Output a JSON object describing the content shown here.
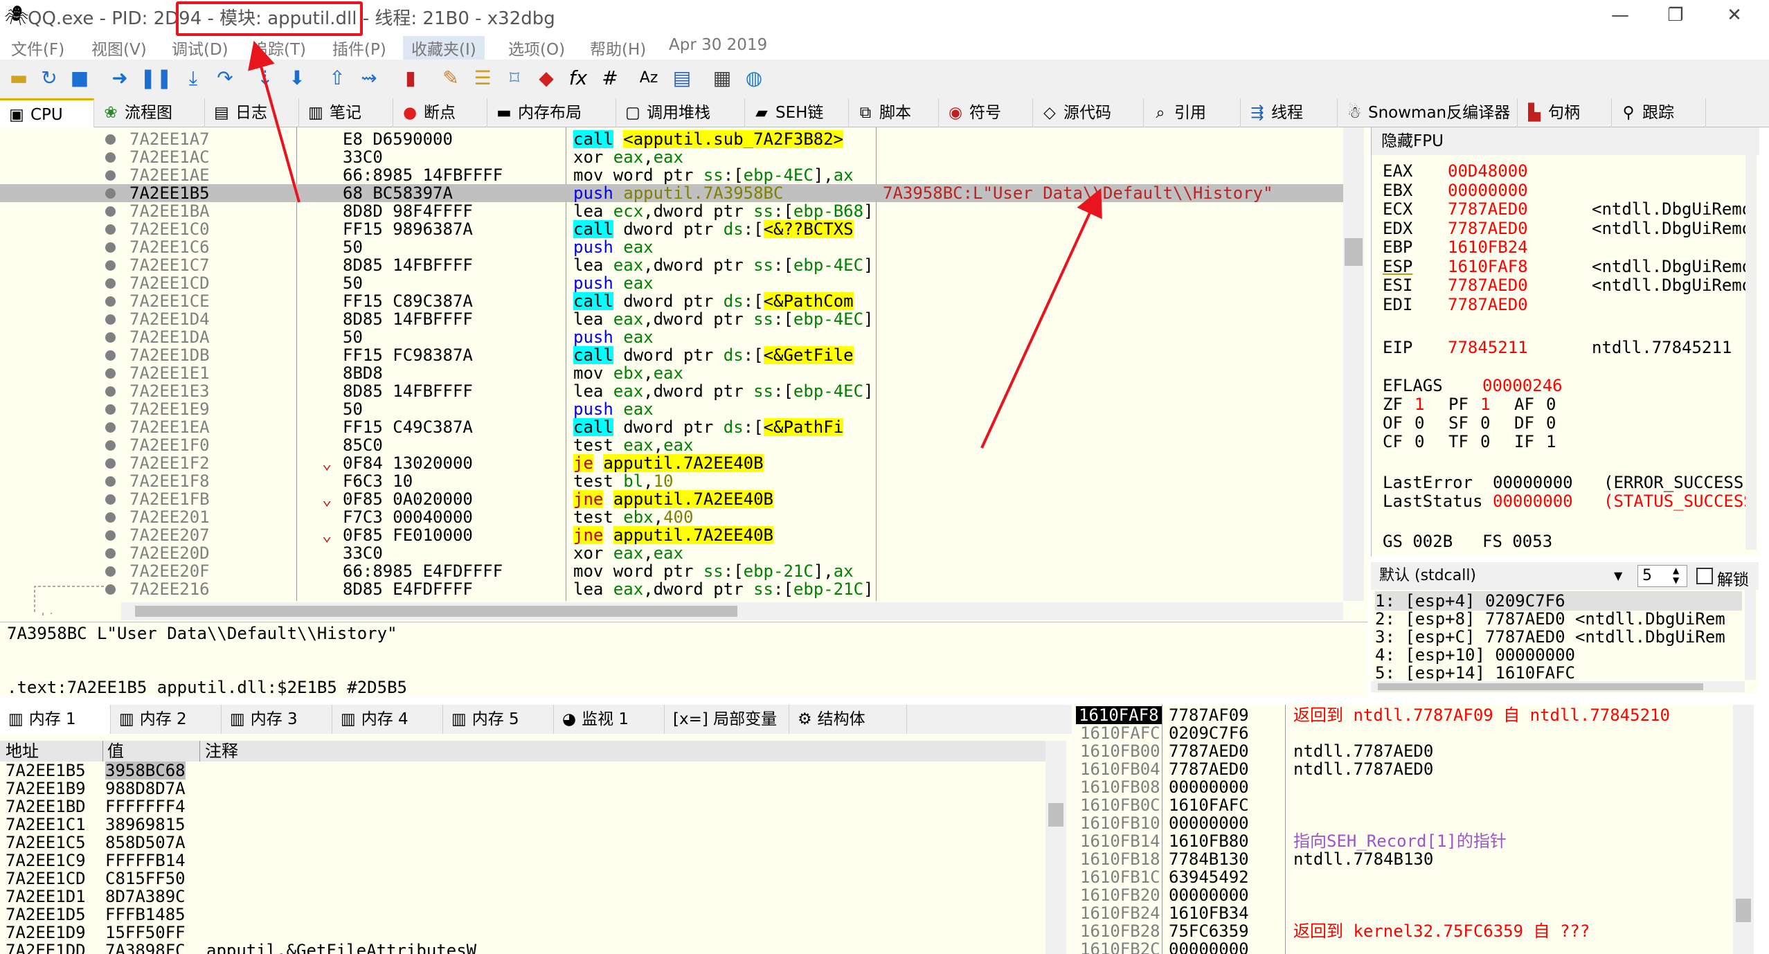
{
  "window": {
    "title": "QQ.exe - PID: 2D94 - 模块: apputil.dll - 线程: 21B0 - x32dbg",
    "minimize": "—",
    "maximize": "❐",
    "close": "✕"
  },
  "menu": [
    "文件(F)",
    "视图(V)",
    "调试(D)",
    "追踪(T)",
    "插件(P)",
    "收藏夹(I)",
    "选项(O)",
    "帮助(H)",
    "Apr 30 2019"
  ],
  "toolbar": [
    "open-icon",
    "restart-icon",
    "stop-icon",
    "run-icon",
    "pause-icon",
    "step-into-icon",
    "step-over-icon",
    "trace-into-icon",
    "trace-over-icon",
    "execute-till-return-icon",
    "run-to-user-code-icon",
    "scylla-icon",
    "patch-icon",
    "comment-icon",
    "label-icon",
    "bookmark-icon",
    "function-icon",
    "hash-icon",
    "strings-icon",
    "calls-icon",
    "calculator-icon",
    "globe-icon"
  ],
  "tabs": [
    {
      "icon": "cpu-icon",
      "label": "CPU"
    },
    {
      "icon": "graph-icon",
      "label": "流程图"
    },
    {
      "icon": "log-icon",
      "label": "日志"
    },
    {
      "icon": "notes-icon",
      "label": "笔记"
    },
    {
      "icon": "breakpoint-icon",
      "label": "断点"
    },
    {
      "icon": "memory-map-icon",
      "label": "内存布局"
    },
    {
      "icon": "callstack-icon",
      "label": "调用堆栈"
    },
    {
      "icon": "seh-icon",
      "label": "SEH链"
    },
    {
      "icon": "script-icon",
      "label": "脚本"
    },
    {
      "icon": "symbol-icon",
      "label": "符号"
    },
    {
      "icon": "source-icon",
      "label": "源代码"
    },
    {
      "icon": "references-icon",
      "label": "引用"
    },
    {
      "icon": "threads-icon",
      "label": "线程"
    },
    {
      "icon": "snowman-icon",
      "label": "Snowman反编译器"
    },
    {
      "icon": "handles-icon",
      "label": "句柄"
    },
    {
      "icon": "trace-icon",
      "label": "跟踪"
    }
  ],
  "disasm": [
    {
      "addr": "7A2EE1A7",
      "bytes": "E8 D6590000",
      "instr": [
        {
          "t": "call",
          "c": "kw-call"
        },
        {
          "t": " "
        },
        {
          "t": "<apputil.sub_7A2F3B82>",
          "c": "hl-y"
        }
      ]
    },
    {
      "addr": "7A2EE1AC",
      "bytes": "33C0",
      "instr": [
        {
          "t": "xor "
        },
        {
          "t": "eax",
          "c": "reg"
        },
        {
          "t": ","
        },
        {
          "t": "eax",
          "c": "reg"
        }
      ]
    },
    {
      "addr": "7A2EE1AE",
      "bytes": "66:8985 14FBFFFF",
      "instr": [
        {
          "t": "mov word ptr "
        },
        {
          "t": "ss",
          "c": "seg"
        },
        {
          "t": ":["
        },
        {
          "t": "ebp-4EC",
          "c": "reg"
        },
        {
          "t": "],"
        },
        {
          "t": "ax",
          "c": "reg"
        }
      ]
    },
    {
      "addr": "7A2EE1B5",
      "bytes": "68 BC58397A",
      "sel": true,
      "instr": [
        {
          "t": "push",
          "c": "kw-push"
        },
        {
          "t": " apputil.7A3958BC",
          "c": "num"
        }
      ],
      "comment": "7A3958BC:L\"User Data\\\\Default\\\\History\""
    },
    {
      "addr": "7A2EE1BA",
      "bytes": "8D8D 98F4FFFF",
      "instr": [
        {
          "t": "lea "
        },
        {
          "t": "ecx",
          "c": "reg"
        },
        {
          "t": ",dword ptr "
        },
        {
          "t": "ss",
          "c": "seg"
        },
        {
          "t": ":["
        },
        {
          "t": "ebp-B68",
          "c": "reg"
        },
        {
          "t": "]"
        }
      ]
    },
    {
      "addr": "7A2EE1C0",
      "bytes": "FF15 9896387A",
      "instr": [
        {
          "t": "call",
          "c": "kw-call"
        },
        {
          "t": " dword ptr "
        },
        {
          "t": "ds",
          "c": "seg"
        },
        {
          "t": ":["
        },
        {
          "t": "<&??BCTXS",
          "c": "hl-y"
        }
      ]
    },
    {
      "addr": "7A2EE1C6",
      "bytes": "50",
      "instr": [
        {
          "t": "push",
          "c": "kw-push"
        },
        {
          "t": " "
        },
        {
          "t": "eax",
          "c": "reg"
        }
      ]
    },
    {
      "addr": "7A2EE1C7",
      "bytes": "8D85 14FBFFFF",
      "instr": [
        {
          "t": "lea "
        },
        {
          "t": "eax",
          "c": "reg"
        },
        {
          "t": ",dword ptr "
        },
        {
          "t": "ss",
          "c": "seg"
        },
        {
          "t": ":["
        },
        {
          "t": "ebp-4EC",
          "c": "reg"
        },
        {
          "t": "]"
        }
      ]
    },
    {
      "addr": "7A2EE1CD",
      "bytes": "50",
      "instr": [
        {
          "t": "push",
          "c": "kw-push"
        },
        {
          "t": " "
        },
        {
          "t": "eax",
          "c": "reg"
        }
      ]
    },
    {
      "addr": "7A2EE1CE",
      "bytes": "FF15 C89C387A",
      "instr": [
        {
          "t": "call",
          "c": "kw-call"
        },
        {
          "t": " dword ptr "
        },
        {
          "t": "ds",
          "c": "seg"
        },
        {
          "t": ":["
        },
        {
          "t": "<&PathCom",
          "c": "hl-y"
        }
      ]
    },
    {
      "addr": "7A2EE1D4",
      "bytes": "8D85 14FBFFFF",
      "instr": [
        {
          "t": "lea "
        },
        {
          "t": "eax",
          "c": "reg"
        },
        {
          "t": ",dword ptr "
        },
        {
          "t": "ss",
          "c": "seg"
        },
        {
          "t": ":["
        },
        {
          "t": "ebp-4EC",
          "c": "reg"
        },
        {
          "t": "]"
        }
      ]
    },
    {
      "addr": "7A2EE1DA",
      "bytes": "50",
      "instr": [
        {
          "t": "push",
          "c": "kw-push"
        },
        {
          "t": " "
        },
        {
          "t": "eax",
          "c": "reg"
        }
      ]
    },
    {
      "addr": "7A2EE1DB",
      "bytes": "FF15 FC98387A",
      "instr": [
        {
          "t": "call",
          "c": "kw-call"
        },
        {
          "t": " dword ptr "
        },
        {
          "t": "ds",
          "c": "seg"
        },
        {
          "t": ":["
        },
        {
          "t": "<&GetFile",
          "c": "hl-y"
        }
      ]
    },
    {
      "addr": "7A2EE1E1",
      "bytes": "8BD8",
      "instr": [
        {
          "t": "mov "
        },
        {
          "t": "ebx",
          "c": "reg"
        },
        {
          "t": ","
        },
        {
          "t": "eax",
          "c": "reg"
        }
      ]
    },
    {
      "addr": "7A2EE1E3",
      "bytes": "8D85 14FBFFFF",
      "instr": [
        {
          "t": "lea "
        },
        {
          "t": "eax",
          "c": "reg"
        },
        {
          "t": ",dword ptr "
        },
        {
          "t": "ss",
          "c": "seg"
        },
        {
          "t": ":["
        },
        {
          "t": "ebp-4EC",
          "c": "reg"
        },
        {
          "t": "]"
        }
      ]
    },
    {
      "addr": "7A2EE1E9",
      "bytes": "50",
      "instr": [
        {
          "t": "push",
          "c": "kw-push"
        },
        {
          "t": " "
        },
        {
          "t": "eax",
          "c": "reg"
        }
      ]
    },
    {
      "addr": "7A2EE1EA",
      "bytes": "FF15 C49C387A",
      "instr": [
        {
          "t": "call",
          "c": "kw-call"
        },
        {
          "t": " dword ptr "
        },
        {
          "t": "ds",
          "c": "seg"
        },
        {
          "t": ":["
        },
        {
          "t": "<&PathFi",
          "c": "hl-y"
        }
      ]
    },
    {
      "addr": "7A2EE1F0",
      "bytes": "85C0",
      "instr": [
        {
          "t": "test "
        },
        {
          "t": "eax",
          "c": "reg"
        },
        {
          "t": ","
        },
        {
          "t": "eax",
          "c": "reg"
        }
      ]
    },
    {
      "addr": "7A2EE1F2",
      "bytes": "0F84 13020000",
      "mark": "⌄",
      "instr": [
        {
          "t": "je",
          "c": "kw-jmp"
        },
        {
          "t": " "
        },
        {
          "t": "apputil.7A2EE40B",
          "c": "hl-y"
        }
      ]
    },
    {
      "addr": "7A2EE1F8",
      "bytes": "F6C3 10",
      "instr": [
        {
          "t": "test "
        },
        {
          "t": "bl",
          "c": "reg"
        },
        {
          "t": ","
        },
        {
          "t": "10",
          "c": "num"
        }
      ]
    },
    {
      "addr": "7A2EE1FB",
      "bytes": "0F85 0A020000",
      "mark": "⌄",
      "instr": [
        {
          "t": "jne",
          "c": "kw-jmp"
        },
        {
          "t": " "
        },
        {
          "t": "apputil.7A2EE40B",
          "c": "hl-y"
        }
      ]
    },
    {
      "addr": "7A2EE201",
      "bytes": "F7C3 00040000",
      "instr": [
        {
          "t": "test "
        },
        {
          "t": "ebx",
          "c": "reg"
        },
        {
          "t": ","
        },
        {
          "t": "400",
          "c": "num"
        }
      ]
    },
    {
      "addr": "7A2EE207",
      "bytes": "0F85 FE010000",
      "mark": "⌄",
      "instr": [
        {
          "t": "jne",
          "c": "kw-jmp"
        },
        {
          "t": " "
        },
        {
          "t": "apputil.7A2EE40B",
          "c": "hl-y"
        }
      ]
    },
    {
      "addr": "7A2EE20D",
      "bytes": "33C0",
      "instr": [
        {
          "t": "xor "
        },
        {
          "t": "eax",
          "c": "reg"
        },
        {
          "t": ","
        },
        {
          "t": "eax",
          "c": "reg"
        }
      ]
    },
    {
      "addr": "7A2EE20F",
      "bytes": "66:8985 E4FDFFFF",
      "instr": [
        {
          "t": "mov word ptr "
        },
        {
          "t": "ss",
          "c": "seg"
        },
        {
          "t": ":["
        },
        {
          "t": "ebp-21C",
          "c": "reg"
        },
        {
          "t": "],"
        },
        {
          "t": "ax",
          "c": "reg"
        }
      ]
    },
    {
      "addr": "7A2EE216",
      "bytes": "8D85 E4FDFFFF",
      "instr": [
        {
          "t": "lea "
        },
        {
          "t": "eax",
          "c": "reg"
        },
        {
          "t": ",dword ptr "
        },
        {
          "t": "ss",
          "c": "seg"
        },
        {
          "t": ":["
        },
        {
          "t": "ebp-21C",
          "c": "reg"
        },
        {
          "t": "]"
        }
      ]
    }
  ],
  "fpu_toggle": "隐藏FPU",
  "registers": [
    {
      "name": "EAX",
      "value": "00D48000",
      "comment": ""
    },
    {
      "name": "EBX",
      "value": "00000000",
      "comment": ""
    },
    {
      "name": "ECX",
      "value": "7787AED0",
      "comment": "<ntdll.DbgUiRemo"
    },
    {
      "name": "EDX",
      "value": "7787AED0",
      "comment": "<ntdll.DbgUiRemo"
    },
    {
      "name": "EBP",
      "value": "1610FB24",
      "comment": ""
    },
    {
      "name": "ESP",
      "value": "1610FAF8",
      "comment": "<ntdll.DbgUiRemo"
    },
    {
      "name": "ESI",
      "value": "7787AED0",
      "comment": "<ntdll.DbgUiRemo"
    },
    {
      "name": "EDI",
      "value": "7787AED0",
      "comment": ""
    }
  ],
  "eip": {
    "name": "EIP",
    "value": "77845211",
    "comment": "ntdll.77845211"
  },
  "eflags": {
    "name": "EFLAGS",
    "value": "00000246"
  },
  "flags": [
    [
      "ZF",
      "1",
      "PF",
      "1",
      "AF",
      "0"
    ],
    [
      "OF",
      "0",
      "SF",
      "0",
      "DF",
      "0"
    ],
    [
      "CF",
      "0",
      "TF",
      "0",
      "IF",
      "1"
    ]
  ],
  "last_error": {
    "name": "LastError",
    "value": "00000000",
    "desc": "(ERROR_SUCCESS)"
  },
  "last_status": {
    "name": "LastStatus",
    "value": "00000000",
    "desc": "(STATUS_SUCCESS"
  },
  "segs": {
    "gs": "GS 002B",
    "fs": "FS 0053"
  },
  "callconv": {
    "value": "默认 (stdcall)",
    "count": "5",
    "unlock": "解锁"
  },
  "args": [
    "1: [esp+4]  0209C7F6",
    "2: [esp+8]  7787AED0 <ntdll.DbgUiRem",
    "3: [esp+C]  7787AED0 <ntdll.DbgUiRem",
    "4: [esp+10] 00000000",
    "5: [esp+14] 1610FAFC"
  ],
  "info": {
    "line1": "7A3958BC L\"User Data\\\\Default\\\\History\"",
    "line2": ".text:7A2EE1B5 apputil.dll:$2E1B5 #2D5B5"
  },
  "btabs": [
    {
      "icon": "memory-icon",
      "label": "内存 1"
    },
    {
      "icon": "memory-icon",
      "label": "内存 2"
    },
    {
      "icon": "memory-icon",
      "label": "内存 3"
    },
    {
      "icon": "memory-icon",
      "label": "内存 4"
    },
    {
      "icon": "memory-icon",
      "label": "内存 5"
    },
    {
      "icon": "watch-icon",
      "label": "监视 1"
    },
    {
      "icon": "locals-icon",
      "label": "[x=] 局部变量"
    },
    {
      "icon": "struct-icon",
      "label": "结构体"
    }
  ],
  "dump": {
    "headers": [
      "地址",
      "值",
      "注释"
    ],
    "rows": [
      [
        "7A2EE1B5",
        "3958BC68",
        ""
      ],
      [
        "7A2EE1B9",
        "988D8D7A",
        ""
      ],
      [
        "7A2EE1BD",
        "FFFFFFF4",
        ""
      ],
      [
        "7A2EE1C1",
        "38969815",
        ""
      ],
      [
        "7A2EE1C5",
        "858D507A",
        ""
      ],
      [
        "7A2EE1C9",
        "FFFFFB14",
        ""
      ],
      [
        "7A2EE1CD",
        "C815FF50",
        ""
      ],
      [
        "7A2EE1D1",
        "8D7A389C",
        ""
      ],
      [
        "7A2EE1D5",
        "FFFB1485",
        ""
      ],
      [
        "7A2EE1D9",
        "15FF50FF",
        ""
      ],
      [
        "7A2EE1DD",
        "7A3898FC",
        "apputil.&GetFileAttributesW"
      ]
    ]
  },
  "stack": [
    {
      "addr": "1610FAF8",
      "val": "7787AF09",
      "cmt": "返回到 ntdll.7787AF09 自 ntdll.77845210",
      "kind": "ret",
      "sel": true
    },
    {
      "addr": "1610FAFC",
      "val": "0209C7F6",
      "cmt": ""
    },
    {
      "addr": "1610FB00",
      "val": "7787AED0",
      "cmt": "ntdll.7787AED0"
    },
    {
      "addr": "1610FB04",
      "val": "7787AED0",
      "cmt": "ntdll.7787AED0"
    },
    {
      "addr": "1610FB08",
      "val": "00000000",
      "cmt": ""
    },
    {
      "addr": "1610FB0C",
      "val": "1610FAFC",
      "cmt": ""
    },
    {
      "addr": "1610FB10",
      "val": "00000000",
      "cmt": ""
    },
    {
      "addr": "1610FB14",
      "val": "1610FB80",
      "cmt": "指向SEH_Record[1]的指针",
      "kind": "seh"
    },
    {
      "addr": "1610FB18",
      "val": "7784B130",
      "cmt": "ntdll.7784B130"
    },
    {
      "addr": "1610FB1C",
      "val": "63945492",
      "cmt": ""
    },
    {
      "addr": "1610FB20",
      "val": "00000000",
      "cmt": ""
    },
    {
      "addr": "1610FB24",
      "val": "1610FB34",
      "cmt": ""
    },
    {
      "addr": "1610FB28",
      "val": "75FC6359",
      "cmt": "返回到 kernel32.75FC6359 自 ???",
      "kind": "ret"
    },
    {
      "addr": "1610FB2C",
      "val": "00000000",
      "cmt": ""
    }
  ],
  "colors": {
    "annotation_red": "#e8141e",
    "reg_changed": "#ff0000",
    "bg_panel": "#fffff0"
  }
}
